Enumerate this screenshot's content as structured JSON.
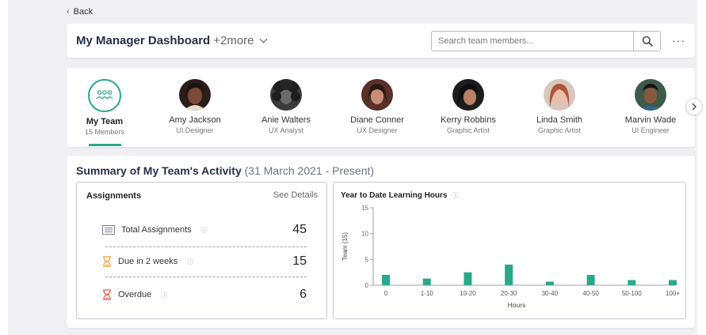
{
  "nav": {
    "back_label": "Back"
  },
  "header": {
    "title": "My Manager Dashboard",
    "more": "+2more",
    "search_placeholder": "Search team members...",
    "menu_glyph": "···"
  },
  "team": [
    {
      "name": "My Team",
      "role": "15 Members",
      "selected": true
    },
    {
      "name": "Amy Jackson",
      "role": "UI Designer"
    },
    {
      "name": "Anie Walters",
      "role": "UX Analyst"
    },
    {
      "name": "Diane Conner",
      "role": "UX Designer"
    },
    {
      "name": "Kerry Robbins",
      "role": "Graphic Artist"
    },
    {
      "name": "Linda Smith",
      "role": "Graphic Artist"
    },
    {
      "name": "Marvin Wade",
      "role": "UI Engineer"
    }
  ],
  "summary": {
    "title": "Summary of My Team's Activity",
    "range": "(31 March 2021 - Present)",
    "assignments": {
      "title": "Assignments",
      "see_details": "See Details",
      "info_glyph": "ⓘ",
      "rows": [
        {
          "label": "Total Assignments",
          "value": "45",
          "icon": "list-icon"
        },
        {
          "label": "Due in 2 weeks",
          "value": "15",
          "icon": "hourglass-icon"
        },
        {
          "label": "Overdue",
          "value": "6",
          "icon": "hourglass-red-icon"
        }
      ]
    },
    "learning": {
      "title": "Year to Date Learning Hours",
      "info_glyph": "ⓘ"
    }
  },
  "colors": {
    "accent": "#2aa88a",
    "due": "#f0a030",
    "overdue": "#e0604a"
  },
  "chart_data": {
    "type": "bar",
    "title": "Year to Date Learning Hours",
    "categories": [
      "0",
      "1-10",
      "10-20",
      "20-30",
      "30-40",
      "40-50",
      "50-100",
      "100+"
    ],
    "values": [
      2,
      1.3,
      2.5,
      4,
      0.7,
      2,
      1,
      1
    ],
    "xlabel": "Hours",
    "ylabel": "Team (15)",
    "ylim": [
      0,
      15
    ],
    "yticks": [
      "0",
      "5",
      "10",
      "15"
    ],
    "grid": false
  }
}
